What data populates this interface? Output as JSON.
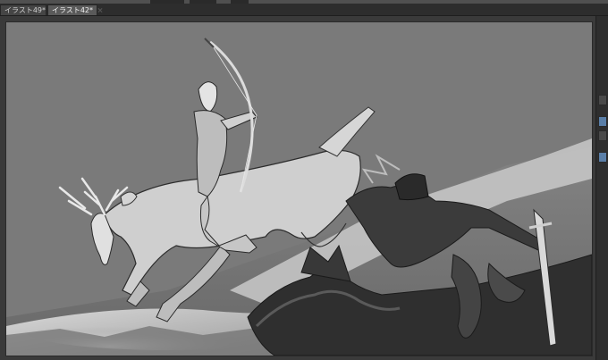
{
  "tabs": [
    {
      "label": "イラスト49*",
      "active": false
    },
    {
      "label": "イラスト42*",
      "active": true
    }
  ],
  "colors": {
    "canvas_bg": "#777777",
    "workspace_bg": "#3a3a3a",
    "tab_active": "#5a5a5a",
    "accent": "#5a7fa8"
  },
  "icons": {
    "tab_close": "close-icon"
  }
}
